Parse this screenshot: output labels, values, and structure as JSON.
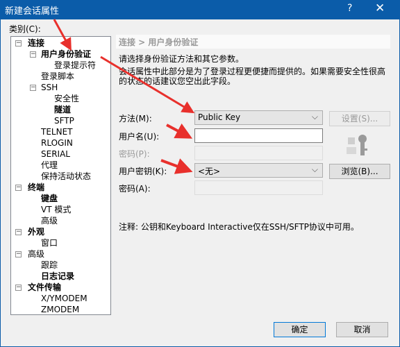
{
  "window": {
    "title": "新建会话属性",
    "help": "?",
    "close": "✕"
  },
  "category_label": "类别(C):",
  "tree": [
    {
      "label": "连接",
      "level": 0,
      "bold": true,
      "expander": "−"
    },
    {
      "label": "用户身份验证",
      "level": 1,
      "bold": true,
      "expander": "−"
    },
    {
      "label": "登录提示符",
      "level": 2,
      "bold": false
    },
    {
      "label": "登录脚本",
      "level": 1,
      "bold": false
    },
    {
      "label": "SSH",
      "level": 1,
      "bold": false,
      "expander": "−"
    },
    {
      "label": "安全性",
      "level": 2,
      "bold": false
    },
    {
      "label": "隧道",
      "level": 2,
      "bold": true
    },
    {
      "label": "SFTP",
      "level": 2,
      "bold": false
    },
    {
      "label": "TELNET",
      "level": 1,
      "bold": false
    },
    {
      "label": "RLOGIN",
      "level": 1,
      "bold": false
    },
    {
      "label": "SERIAL",
      "level": 1,
      "bold": false
    },
    {
      "label": "代理",
      "level": 1,
      "bold": false
    },
    {
      "label": "保持活动状态",
      "level": 1,
      "bold": false
    },
    {
      "label": "终端",
      "level": 0,
      "bold": true,
      "expander": "−"
    },
    {
      "label": "键盘",
      "level": 1,
      "bold": true
    },
    {
      "label": "VT 模式",
      "level": 1,
      "bold": false
    },
    {
      "label": "高级",
      "level": 1,
      "bold": false
    },
    {
      "label": "外观",
      "level": 0,
      "bold": true,
      "expander": "−"
    },
    {
      "label": "窗口",
      "level": 1,
      "bold": false
    },
    {
      "label": "高级",
      "level": 0,
      "bold": false,
      "expander": "−"
    },
    {
      "label": "跟踪",
      "level": 1,
      "bold": false
    },
    {
      "label": "日志记录",
      "level": 1,
      "bold": true
    },
    {
      "label": "文件传输",
      "level": 0,
      "bold": true,
      "expander": "−"
    },
    {
      "label": "X/YMODEM",
      "level": 1,
      "bold": false
    },
    {
      "label": "ZMODEM",
      "level": 1,
      "bold": false
    }
  ],
  "panel": {
    "breadcrumb": "连接 > 用户身份验证",
    "intro": "请选择身份验证方法和其它参数。",
    "desc1": "会话属性中此部分是为了登录过程更便捷而提供的。如果需要安全性很高",
    "desc2": "的状态的话建议您空出此字段。",
    "method_label": "方法(M):",
    "method_value": "Public Key",
    "settings_button": "设置(S)...",
    "username_label": "用户名(U):",
    "username_value": "",
    "password_label": "密码(P):",
    "userkey_label": "用户密钥(K):",
    "userkey_value": "<无>",
    "browse_button": "浏览(B)...",
    "passphrase_label": "密码(A):",
    "note": "注释: 公钥和Keyboard Interactive仅在SSH/SFTP协议中可用。"
  },
  "footer": {
    "ok": "确定",
    "cancel": "取消"
  },
  "colors": {
    "titlebar": "#0b5ca9",
    "arrow": "#e8302c"
  }
}
